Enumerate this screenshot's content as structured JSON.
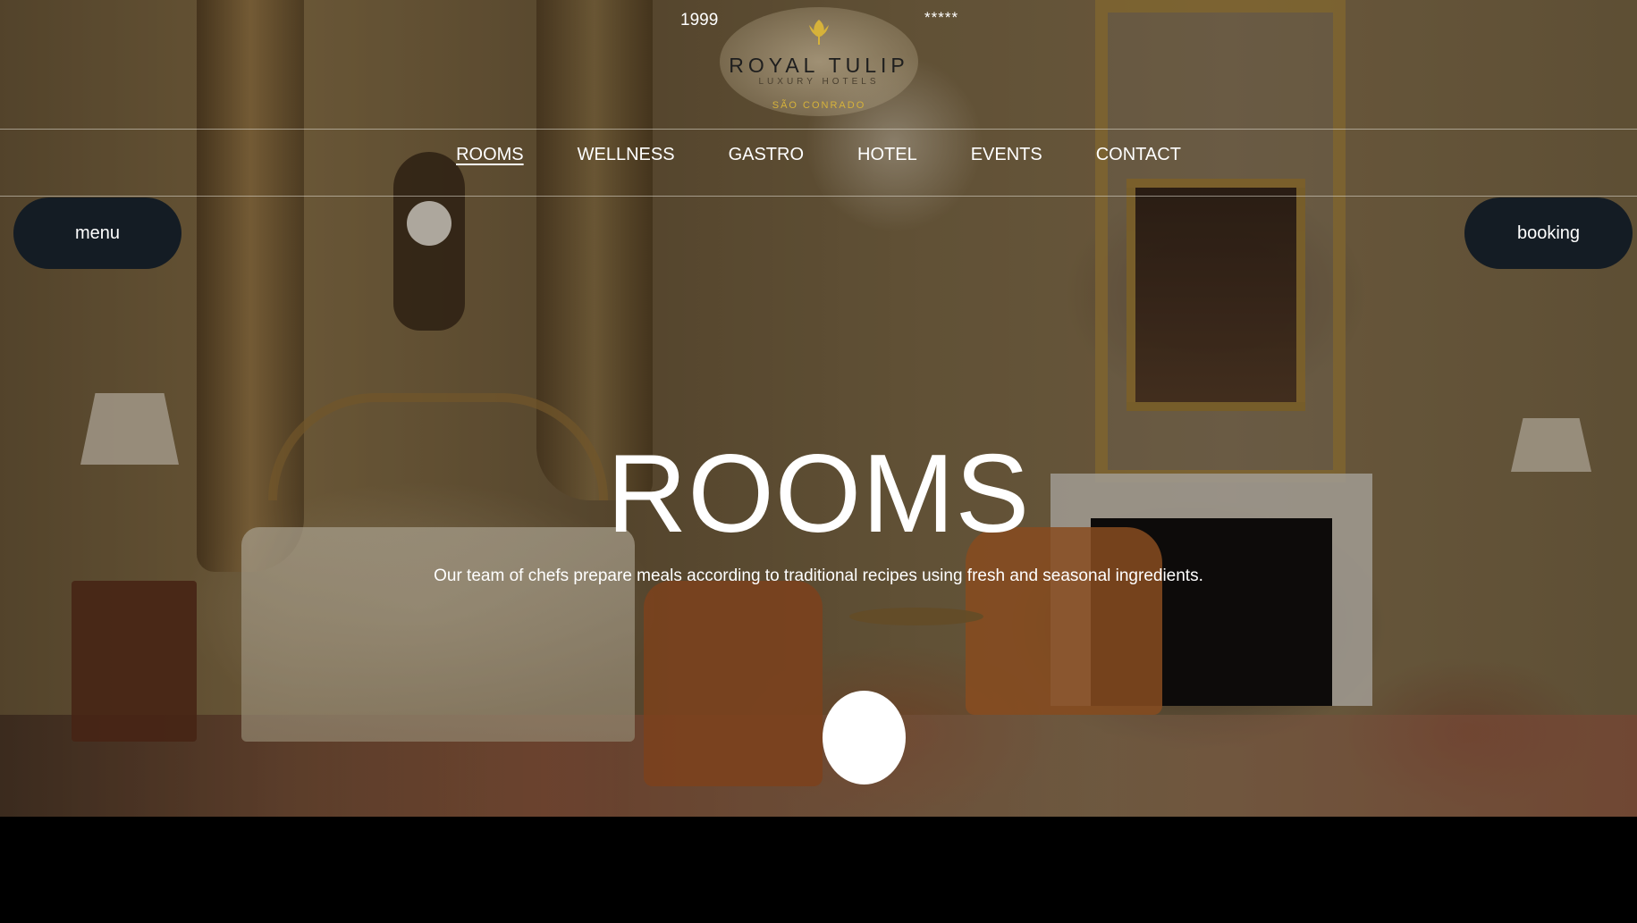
{
  "header": {
    "year": "1999",
    "stars": "*****",
    "logo": {
      "name": "ROYAL TULIP",
      "subtitle": "LUXURY HOTELS",
      "location": "SÃO CONRADO",
      "accent_color": "#d6b23a",
      "icon": "tulip-icon"
    }
  },
  "nav": {
    "items": [
      {
        "label": "ROOMS",
        "active": true
      },
      {
        "label": "WELLNESS",
        "active": false
      },
      {
        "label": "GASTRO",
        "active": false
      },
      {
        "label": "HOTEL",
        "active": false
      },
      {
        "label": "EVENTS",
        "active": false
      },
      {
        "label": "CONTACT",
        "active": false
      }
    ]
  },
  "buttons": {
    "menu_label": "menu",
    "booking_label": "booking",
    "color": "#141c24"
  },
  "hero": {
    "title": "ROOMS",
    "subtitle": "Our team of chefs prepare meals according to traditional recipes using fresh and seasonal ingredients."
  }
}
